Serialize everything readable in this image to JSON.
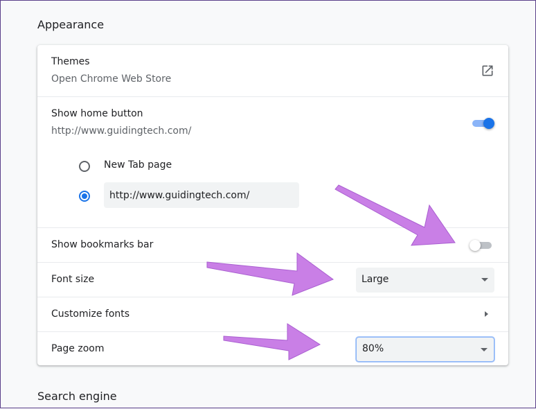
{
  "sections": {
    "appearance_title": "Appearance",
    "search_engine_title": "Search engine"
  },
  "themes": {
    "label": "Themes",
    "sublabel": "Open Chrome Web Store",
    "icon": "external-link-icon"
  },
  "home_button": {
    "label": "Show home button",
    "sublabel": "http://www.guidingtech.com/",
    "enabled": true,
    "options": {
      "new_tab_label": "New Tab page",
      "custom_url_value": "http://www.guidingtech.com/"
    },
    "selected_option": "custom_url"
  },
  "bookmarks_bar": {
    "label": "Show bookmarks bar",
    "enabled": false
  },
  "font_size": {
    "label": "Font size",
    "selected": "Large"
  },
  "customize_fonts": {
    "label": "Customize fonts",
    "icon": "arrow-right-icon"
  },
  "page_zoom": {
    "label": "Page zoom",
    "selected": "80%"
  },
  "colors": {
    "accent": "#1a73e8",
    "annotation_arrow": "#c97fe6"
  }
}
